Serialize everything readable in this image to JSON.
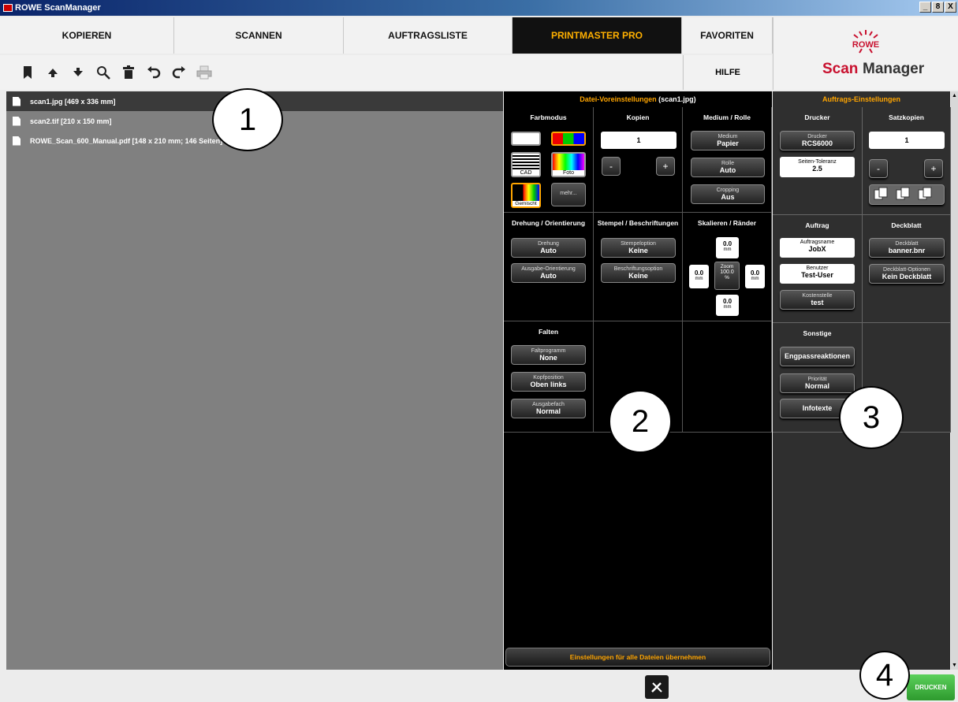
{
  "window": {
    "title": "ROWE ScanManager",
    "buttons": [
      "_",
      "8",
      "X"
    ]
  },
  "tabs": [
    "KOPIEREN",
    "SCANNEN",
    "AUFTRAGSLISTE",
    "PRINTMASTER PRO",
    "FAVORITEN"
  ],
  "help_label": "HILFE",
  "logo": {
    "brand": "ROWE",
    "product_a": "Scan",
    "product_b": "Manager"
  },
  "toolbar_icons": [
    "bookmark-icon",
    "arrow-up-icon",
    "arrow-down-icon",
    "magnifier-icon",
    "trash-icon",
    "undo-icon",
    "redo-icon",
    "printer-icon"
  ],
  "files": [
    "scan1.jpg [469 x 336 mm]",
    "scan2.tif [210 x 150 mm]",
    "ROWE_Scan_600_Manual.pdf [148 x 210 mm; 146 Seiten]"
  ],
  "datei": {
    "head_a": "Datei-Voreinstellungen",
    "head_b": "(scan1.jpg)",
    "farbmodus": {
      "title": "Farbmodus",
      "cad": "CAD",
      "foto": "Foto",
      "gemischt": "Gemischt",
      "mehr": "mehr..."
    },
    "kopien": {
      "title": "Kopien",
      "value": "1",
      "minus": "-",
      "plus": "+"
    },
    "medium": {
      "title": "Medium / Rolle",
      "medium_l": "Medium",
      "medium_v": "Papier",
      "rolle_l": "Rolle",
      "rolle_v": "Auto",
      "crop_l": "Cropping",
      "crop_v": "Aus"
    },
    "drehung": {
      "title": "Drehung / Orientierung",
      "d_l": "Drehung",
      "d_v": "Auto",
      "o_l": "Ausgabe-Orientierung",
      "o_v": "Auto"
    },
    "stempel": {
      "title": "Stempel / Beschriftungen",
      "s_l": "Stempeloption",
      "s_v": "Keine",
      "b_l": "Beschriftungsoption",
      "b_v": "Keine"
    },
    "skalieren": {
      "title": "Skalieren / Ränder",
      "top": "0.0",
      "left": "0.0",
      "right": "0.0",
      "bottom": "0.0",
      "unit": "mm",
      "zoom_l": "Zoom",
      "zoom_v": "100.0",
      "zoom_u": "%"
    },
    "falten": {
      "title": "Falten",
      "fp_l": "Faltprogramm",
      "fp_v": "None",
      "kp_l": "Kopfposition",
      "kp_v": "Oben links",
      "af_l": "Ausgabefach",
      "af_v": "Normal"
    },
    "apply_all": "Einstellungen für alle Dateien übernehmen"
  },
  "auftrag": {
    "head": "Auftrags-Einstellungen",
    "drucker": {
      "title": "Drucker",
      "d_l": "Drucker",
      "d_v": "RCS6000",
      "t_l": "Seiten-Toleranz",
      "t_v": "2.5"
    },
    "satz": {
      "title": "Satzkopien",
      "value": "1",
      "minus": "-",
      "plus": "+"
    },
    "job": {
      "title": "Auftrag",
      "n_l": "Auftragsname",
      "n_v": "JobX",
      "u_l": "Benutzer",
      "u_v": "Test-User",
      "k_l": "Kostenstelle",
      "k_v": "test"
    },
    "deckblatt": {
      "title": "Deckblatt",
      "d_l": "Deckblatt",
      "d_v": "banner.bnr",
      "o_l": "Deckblatt-Optionen",
      "o_v": "Kein Deckblatt"
    },
    "sonstige": {
      "title": "Sonstige",
      "eng": "Engpassreaktionen",
      "p_l": "Priorität",
      "p_v": "Normal",
      "info": "Infotexte"
    }
  },
  "print_button": "DRUCKEN",
  "callouts": [
    "1",
    "2",
    "3",
    "4"
  ],
  "colors": {
    "accent": "#ffa500",
    "active_tab": "#111111",
    "print": "#3cb43c"
  }
}
